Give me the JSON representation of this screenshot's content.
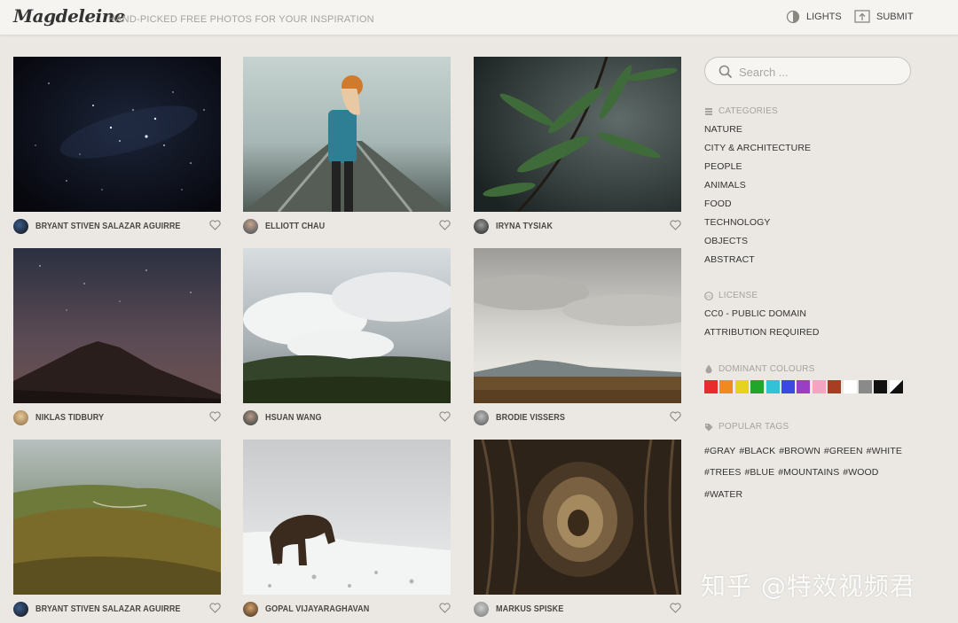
{
  "header": {
    "logo": "Magdeleine",
    "tagline": "HAND-PICKED FREE PHOTOS FOR YOUR INSPIRATION",
    "lights_label": "LIGHTS",
    "submit_label": "SUBMIT"
  },
  "photos": [
    {
      "author": "BRYANT STIVEN SALAZAR AGUIRRE",
      "subject": "starry night sky"
    },
    {
      "author": "ELLIOTT CHAU",
      "subject": "girl on railway in fog"
    },
    {
      "author": "IRYNA TYSIAK",
      "subject": "plant with raindrops"
    },
    {
      "author": "NIKLAS TIDBURY",
      "subject": "mountain under night sky"
    },
    {
      "author": "HSUAN WANG",
      "subject": "misty clouds over trees"
    },
    {
      "author": "BRODIE VISSERS",
      "subject": "mountain landscape with clouds"
    },
    {
      "author": "BRYANT STIVEN SALAZAR AGUIRRE",
      "subject": "green hills in mist"
    },
    {
      "author": "GOPAL VIJAYARAGHAVAN",
      "subject": "bear in snow"
    },
    {
      "author": "MARKUS SPISKE",
      "subject": "wood texture"
    }
  ],
  "sidebar": {
    "search_placeholder": "Search ...",
    "categories_title": "CATEGORIES",
    "categories": [
      "NATURE",
      "CITY & ARCHITECTURE",
      "PEOPLE",
      "ANIMALS",
      "FOOD",
      "TECHNOLOGY",
      "OBJECTS",
      "ABSTRACT"
    ],
    "license_title": "LICENSE",
    "licenses": [
      "CC0 - PUBLIC DOMAIN",
      "ATTRIBUTION REQUIRED"
    ],
    "colours_title": "DOMINANT COLOURS",
    "colours": [
      "#e62c2c",
      "#f18a1e",
      "#e6d321",
      "#22a52b",
      "#2ec4d6",
      "#3a49e0",
      "#9a3ec4",
      "#f2a4c2",
      "#a83d24",
      "#ffffff",
      "#8a8a8a",
      "#111111",
      "bw"
    ],
    "tags_title": "POPULAR TAGS",
    "tags_row1": [
      "#GRAY",
      "#BLACK",
      "#BROWN",
      "#GREEN",
      "#WHITE"
    ],
    "tags_row2": [
      "#TREES",
      "#BLUE",
      "#MOUNTAINS",
      "#WOOD"
    ],
    "tags_row3": [
      "#WATER"
    ]
  },
  "watermark": "知乎 @特效视频君"
}
